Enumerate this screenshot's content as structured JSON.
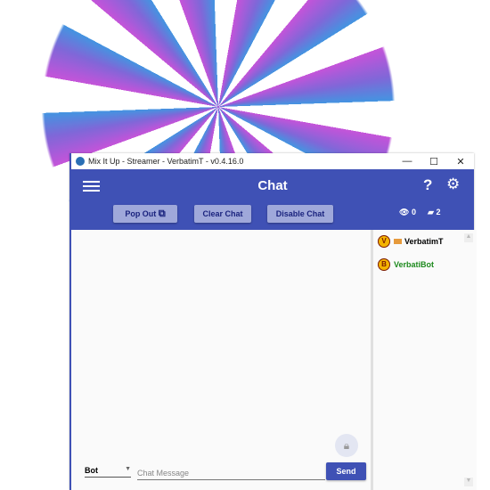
{
  "window": {
    "title": "Mix It Up - Streamer - VerbatimT - v0.4.16.0",
    "minimize": "—",
    "maximize": "☐",
    "close": "✕"
  },
  "header": {
    "title": "Chat",
    "help": "?",
    "settings_icon": "gear-icon"
  },
  "toolbar": {
    "pop_out": "Pop Out",
    "clear_chat": "Clear Chat",
    "disable_chat": "Disable Chat",
    "viewers": "0",
    "chatters": "2"
  },
  "users": [
    {
      "name": "VerbatimT",
      "color": "#000000"
    },
    {
      "name": "VerbatiBot",
      "color": "#1e8a1e"
    }
  ],
  "input": {
    "sender": "Bot",
    "placeholder": "Chat Message",
    "send": "Send"
  },
  "colors": {
    "accent": "#3f51b5",
    "button": "#9fa8da"
  }
}
